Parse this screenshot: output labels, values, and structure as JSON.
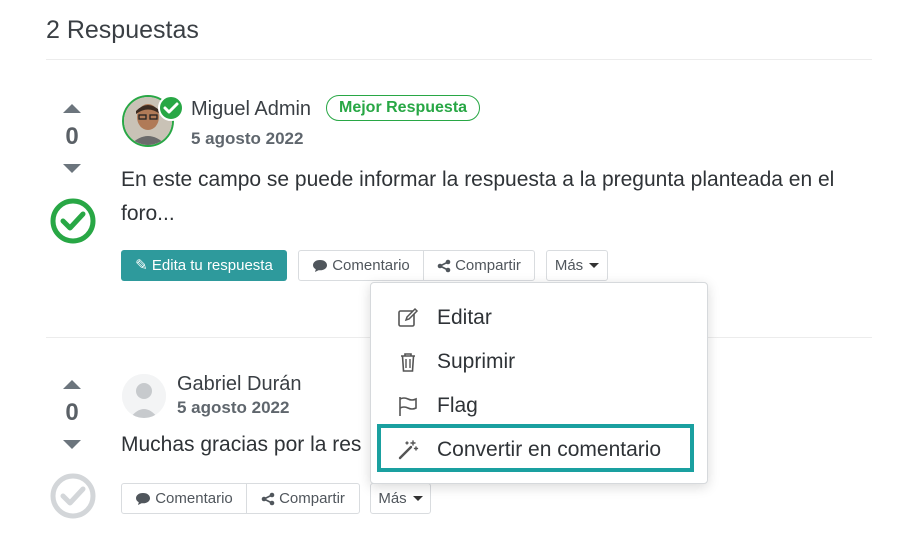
{
  "heading": {
    "title": "2 Respuestas"
  },
  "answers": [
    {
      "votes": "0",
      "author": "Miguel Admin",
      "date": "5 agosto 2022",
      "badge": "Mejor Respuesta",
      "text_line1": "En este campo se puede informar la respuesta a la pregunta planteada en el",
      "text_line2": "foro...",
      "edit_label": "Edita tu respuesta",
      "comment_label": "Comentario",
      "share_label": "Compartir",
      "more_label": "Más",
      "accepted": true
    },
    {
      "votes": "0",
      "author": "Gabriel Durán",
      "date": "5 agosto 2022",
      "text": "Muchas gracias por la res",
      "comment_label": "Comentario",
      "share_label": "Compartir",
      "more_label": "Más",
      "accepted": false
    }
  ],
  "more_menu": {
    "items": [
      {
        "label": "Editar",
        "icon": "edit-icon"
      },
      {
        "label": "Suprimir",
        "icon": "trash-icon"
      },
      {
        "label": "Flag",
        "icon": "flag-icon"
      },
      {
        "label": "Convertir en comentario",
        "icon": "magic-wand-icon",
        "highlighted": true
      }
    ]
  },
  "colors": {
    "accent_teal": "#2e9a9c",
    "success_green": "#28a745",
    "highlight_border": "#1aa0a0"
  }
}
